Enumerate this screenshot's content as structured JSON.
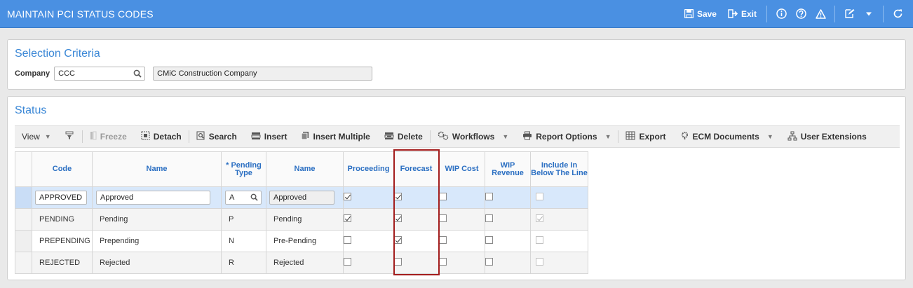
{
  "header": {
    "title": "MAINTAIN PCI STATUS CODES",
    "save_label": "Save",
    "exit_label": "Exit"
  },
  "selection": {
    "title": "Selection Criteria",
    "company_label": "Company",
    "company_value": "CCC",
    "company_name": "CMiC Construction Company"
  },
  "status": {
    "title": "Status",
    "toolbar": {
      "view": "View",
      "freeze": "Freeze",
      "detach": "Detach",
      "search": "Search",
      "insert": "Insert",
      "insert_multiple": "Insert Multiple",
      "delete": "Delete",
      "workflows": "Workflows",
      "report_options": "Report Options",
      "export": "Export",
      "ecm_documents": "ECM Documents",
      "user_extensions": "User Extensions"
    },
    "columns": {
      "code": "Code",
      "name": "Name",
      "pending_type": "* Pending Type",
      "type_name": "Name",
      "proceeding": "Proceeding",
      "forecast": "Forecast",
      "wip_cost": "WIP Cost",
      "wip_revenue": "WIP Revenue",
      "include": "Include In Below The Line"
    },
    "rows": [
      {
        "code": "APPROVED",
        "name": "Approved",
        "type": "A",
        "type_name": "Approved",
        "proceeding": true,
        "forecast": true,
        "wip_cost": false,
        "wip_revenue": false,
        "include": false
      },
      {
        "code": "PENDING",
        "name": "Pending",
        "type": "P",
        "type_name": "Pending",
        "proceeding": true,
        "forecast": true,
        "wip_cost": false,
        "wip_revenue": false,
        "include": true
      },
      {
        "code": "PREPENDING",
        "name": "Prepending",
        "type": "N",
        "type_name": "Pre-Pending",
        "proceeding": false,
        "forecast": true,
        "wip_cost": false,
        "wip_revenue": false,
        "include": false
      },
      {
        "code": "REJECTED",
        "name": "Rejected",
        "type": "R",
        "type_name": "Rejected",
        "proceeding": false,
        "forecast": false,
        "wip_cost": false,
        "wip_revenue": false,
        "include": false
      }
    ]
  },
  "colors": {
    "header_bg": "#4a90e2",
    "title_blue": "#3a87d6",
    "highlight": "#a31d1d",
    "selected_row": "#d8e8fb"
  }
}
